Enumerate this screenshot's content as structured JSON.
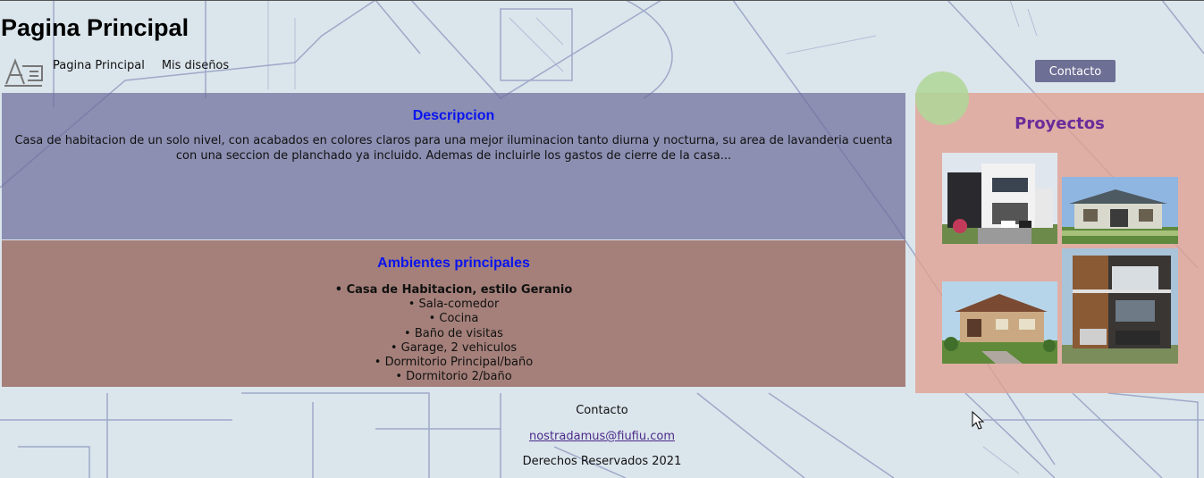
{
  "header": {
    "title": "Pagina Principal"
  },
  "nav": {
    "items": [
      {
        "label": "Pagina Principal"
      },
      {
        "label": "Mis diseños"
      }
    ]
  },
  "contact_button": "Contacto",
  "description": {
    "title": "Descripcion",
    "text": "Casa de habitacion de un solo nivel, con acabados en colores claros para una mejor iluminacion tanto diurna y nocturna, su area de lavanderia cuenta con una seccion de planchado ya incluido. Ademas de incluirle los gastos de cierre de la casa..."
  },
  "ambientes": {
    "title": "Ambientes principales",
    "items": [
      "• Casa de Habitacion, estilo Geranio",
      "• Sala-comedor",
      "• Cocina",
      "• Baño de visitas",
      "• Garage, 2 vehiculos",
      "• Dormitorio Principal/baño",
      "• Dormitorio 2/baño"
    ]
  },
  "proyectos": {
    "title": "Proyectos"
  },
  "footer": {
    "contact_label": "Contacto",
    "email": "nostradamus@fiufiu.com",
    "rights": "Derechos Reservados 2021"
  }
}
